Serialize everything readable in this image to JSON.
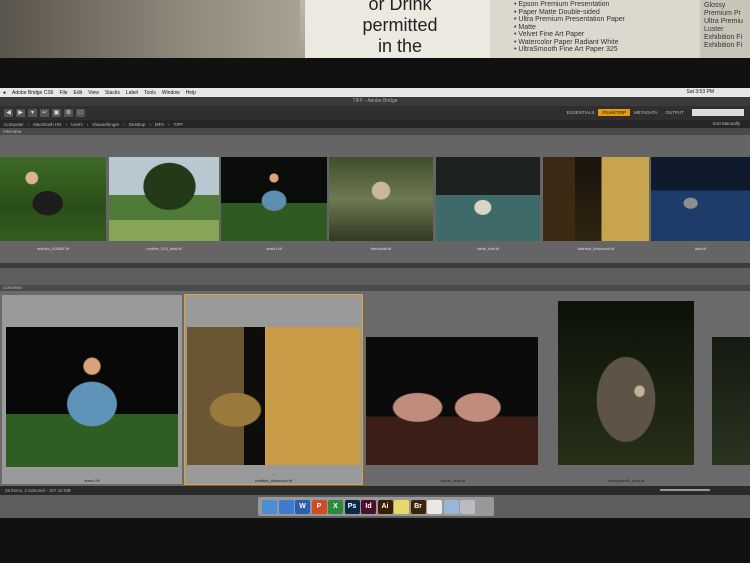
{
  "wall": {
    "sign_lines": [
      "or Drink",
      "permitted",
      "in the"
    ],
    "paper_list": [
      "Epson Premium Presentation",
      "Paper Matte Double-sided",
      "Ultra Premium Presentation Paper",
      "Matte",
      "Velvet Fine Art Paper",
      "Watercolor Paper Radiant White",
      "UltraSmooth Fine Art Paper 325"
    ],
    "paper_right": [
      "Glossy",
      "Premium Pr",
      "Ultra Premiu",
      "Luster",
      "Exhibition Fi",
      "Exhibition Fi"
    ]
  },
  "menubar": {
    "items": [
      "Adobe Bridge CS6",
      "File",
      "Edit",
      "View",
      "Stacks",
      "Label",
      "Tools",
      "Window",
      "Help"
    ],
    "clock": "Sat 3:53 PM"
  },
  "titlebar": {
    "title": "TIFF - Adobe Bridge"
  },
  "toolbar": {
    "workspaces": [
      "ESSENTIALS",
      "FILMSTRIP",
      "METADATA",
      "OUTPUT"
    ],
    "active_workspace": "FILMSTRIP"
  },
  "pathbar": {
    "crumbs": [
      "Computer",
      "Macintosh HD",
      "Users",
      "shausehinger",
      "Desktop",
      "MFA",
      "TIFF"
    ],
    "sort": "Sort Manually"
  },
  "panels": {
    "preview": "PREVIEW",
    "content": "CONTENT"
  },
  "filmstrip": [
    {
      "caption": "mother_014887.tif",
      "style": "p-garden-back"
    },
    {
      "caption": "mother_013_final.tif",
      "style": "p-trees"
    },
    {
      "caption": "arms1.tif",
      "style": "p-blue-girl"
    },
    {
      "caption": "thehands.tif",
      "style": "p-hands"
    },
    {
      "caption": "table_edit.tif",
      "style": "p-table"
    },
    {
      "caption": "bathtub_flowwood.tif",
      "style": "p-window"
    },
    {
      "caption": "lake.tif",
      "style": "p-lake"
    }
  ],
  "content": [
    {
      "caption": "arms1.tif",
      "style": "p-blue-big",
      "selected": true
    },
    {
      "caption": "bathtub_flowwood.tif",
      "style": "p-window-big",
      "selected": true,
      "focus": true,
      "rating": "- -"
    },
    {
      "caption": "boots_crop.tif",
      "style": "p-feet"
    },
    {
      "caption": "cherryhand2_crop.tif",
      "style": "p-forest"
    },
    {
      "caption": "",
      "style": "p-dark"
    }
  ],
  "status": {
    "text": "28 items, 2 selected - 307.18 MB"
  },
  "dock": [
    {
      "name": "finder-icon",
      "label": "",
      "color": "#4a8fd6"
    },
    {
      "name": "safari-icon",
      "label": "",
      "color": "#3c7dd1"
    },
    {
      "name": "word-icon",
      "label": "W",
      "color": "#2b5fb4"
    },
    {
      "name": "powerpoint-icon",
      "label": "P",
      "color": "#d04a26"
    },
    {
      "name": "excel-icon",
      "label": "X",
      "color": "#2c8a3a"
    },
    {
      "name": "photoshop-icon",
      "label": "Ps",
      "color": "#0b2a48"
    },
    {
      "name": "indesign-icon",
      "label": "Id",
      "color": "#4b0f2a"
    },
    {
      "name": "illustrator-icon",
      "label": "Ai",
      "color": "#3b1e00"
    },
    {
      "name": "notes-icon",
      "label": "",
      "color": "#e9d76a"
    },
    {
      "name": "bridge-icon",
      "label": "Br",
      "color": "#3a2408"
    },
    {
      "name": "document-icon",
      "label": "",
      "color": "#e8e8e8"
    },
    {
      "name": "preview-icon",
      "label": "",
      "color": "#9ab6d6"
    },
    {
      "name": "trash-icon",
      "label": "",
      "color": "#b9bcc0"
    }
  ]
}
